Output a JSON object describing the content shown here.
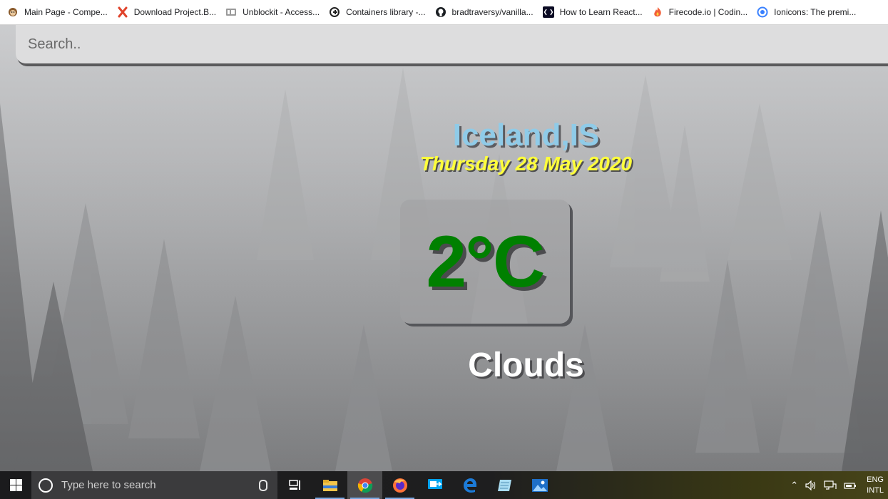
{
  "bookmarks": [
    {
      "label": "Main Page - Compe...",
      "icon": "monkey-icon"
    },
    {
      "label": "Download Project.B...",
      "icon": "x-logo-icon"
    },
    {
      "label": "Unblockit - Access...",
      "icon": "ub-logo-icon"
    },
    {
      "label": "Containers library -...",
      "icon": "containers-icon"
    },
    {
      "label": "bradtraversy/vanilla...",
      "icon": "github-icon"
    },
    {
      "label": "How to Learn React...",
      "icon": "code-icon"
    },
    {
      "label": "Firecode.io | Codin...",
      "icon": "firecode-icon"
    },
    {
      "label": "Ionicons: The premi...",
      "icon": "ionicons-icon"
    }
  ],
  "search": {
    "placeholder": "Search.."
  },
  "weather": {
    "location": "Iceland,IS",
    "date": "Thursday 28 May 2020",
    "temperature": "2°C",
    "condition": "Clouds"
  },
  "taskbar": {
    "search_placeholder": "Type here to search",
    "apps": [
      "file-explorer-icon",
      "chrome-icon",
      "firefox-icon",
      "quick-assist-icon",
      "edge-icon",
      "notepad-icon",
      "photos-icon"
    ],
    "language_line1": "ENG",
    "language_line2": "INTL"
  },
  "colors": {
    "city": "#8fcbe8",
    "date": "#ffff3b",
    "temperature": "#008000",
    "condition": "#ffffff"
  }
}
